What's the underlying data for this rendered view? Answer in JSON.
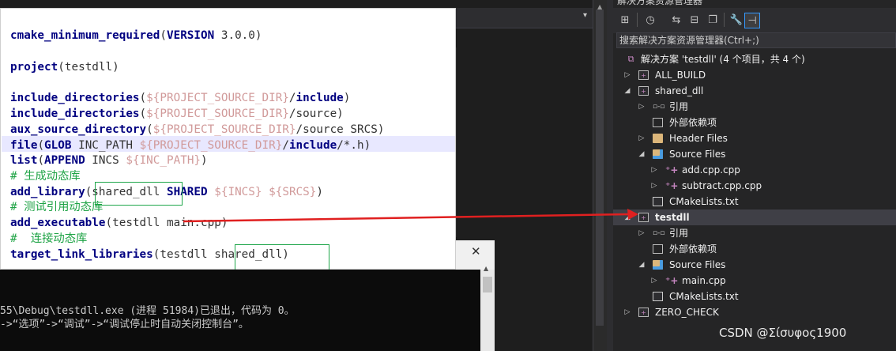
{
  "code": {
    "lines": [
      [
        {
          "t": "kw",
          "s": "cmake_minimum_required"
        },
        {
          "t": "plain",
          "s": "("
        },
        {
          "t": "kw",
          "s": "VERSION"
        },
        {
          "t": "plain",
          "s": " 3.0.0)"
        }
      ],
      [],
      [
        {
          "t": "kw",
          "s": "project"
        },
        {
          "t": "plain",
          "s": "(testdll)"
        }
      ],
      [],
      [
        {
          "t": "kw",
          "s": "include_directories"
        },
        {
          "t": "plain",
          "s": "("
        },
        {
          "t": "var",
          "s": "${PROJECT_SOURCE_DIR}"
        },
        {
          "t": "plain",
          "s": "/"
        },
        {
          "t": "kw",
          "s": "include"
        },
        {
          "t": "plain",
          "s": ")"
        }
      ],
      [
        {
          "t": "kw",
          "s": "include_directories"
        },
        {
          "t": "plain",
          "s": "("
        },
        {
          "t": "var",
          "s": "${PROJECT_SOURCE_DIR}"
        },
        {
          "t": "plain",
          "s": "/source)"
        }
      ],
      [
        {
          "t": "kw",
          "s": "aux_source_directory"
        },
        {
          "t": "plain",
          "s": "("
        },
        {
          "t": "var",
          "s": "${PROJECT_SOURCE_DIR}"
        },
        {
          "t": "plain",
          "s": "/source SRCS)"
        }
      ],
      [
        {
          "t": "kw",
          "s": "file"
        },
        {
          "t": "plain",
          "s": "("
        },
        {
          "t": "kw",
          "s": "GLOB"
        },
        {
          "t": "plain",
          "s": " INC_PATH "
        },
        {
          "t": "var",
          "s": "${PROJECT_SOURCE_DIR}"
        },
        {
          "t": "plain",
          "s": "/"
        },
        {
          "t": "kw",
          "s": "include"
        },
        {
          "t": "plain",
          "s": "/*.h)"
        }
      ],
      [
        {
          "t": "kw",
          "s": "list"
        },
        {
          "t": "plain",
          "s": "("
        },
        {
          "t": "kw",
          "s": "APPEND"
        },
        {
          "t": "plain",
          "s": " INCS "
        },
        {
          "t": "var",
          "s": "${INC_PATH}"
        },
        {
          "t": "plain",
          "s": ")"
        }
      ],
      [
        {
          "t": "cmt",
          "s": "# 生成动态库"
        }
      ],
      [
        {
          "t": "kw",
          "s": "add_library"
        },
        {
          "t": "plain",
          "s": "(shared_dll "
        },
        {
          "t": "kw",
          "s": "SHARED"
        },
        {
          "t": "plain",
          "s": " "
        },
        {
          "t": "var",
          "s": "${INCS}"
        },
        {
          "t": "plain",
          "s": " "
        },
        {
          "t": "var",
          "s": "${SRCS}"
        },
        {
          "t": "plain",
          "s": ")"
        }
      ],
      [
        {
          "t": "cmt",
          "s": "# 测试引用动态库"
        }
      ],
      [
        {
          "t": "kw",
          "s": "add_executable"
        },
        {
          "t": "plain",
          "s": "(testdll main.cpp)"
        }
      ],
      [
        {
          "t": "cmt",
          "s": "#  连接动态库"
        }
      ],
      [
        {
          "t": "kw",
          "s": "target_link_libraries"
        },
        {
          "t": "plain",
          "s": "(testdll shared_dll)"
        }
      ]
    ]
  },
  "console": {
    "close_label": "✕",
    "line1": "55\\Debug\\testdll.exe (进程 51984)已退出，代码为 0。",
    "line2": "->“选项”->“调试”->“调试停止时自动关闭控制台”。"
  },
  "solution_explorer": {
    "title": "解决方案资源管理器",
    "search_placeholder": "搜索解决方案资源管理器(Ctrl+;)",
    "tree": [
      {
        "label": "解决方案 'testdll' (4 个项目，共 4 个)",
        "icon": "solution-icon",
        "glyph": "⧉",
        "ic": "ic-sln",
        "indent": 0,
        "arrow": ""
      },
      {
        "label": "ALL_BUILD",
        "icon": "project-icon",
        "glyph": "+",
        "ic": "ic-proj",
        "indent": 1,
        "arrow": "▷"
      },
      {
        "label": "shared_dll",
        "icon": "project-icon",
        "glyph": "+",
        "ic": "ic-proj",
        "indent": 1,
        "arrow": "◢"
      },
      {
        "label": "引用",
        "icon": "references-icon",
        "glyph": "▫-▫",
        "ic": "ic-ref",
        "indent": 2,
        "arrow": "▷"
      },
      {
        "label": "外部依赖项",
        "icon": "external-deps-icon",
        "glyph": "",
        "ic": "ic-ext",
        "indent": 2,
        "arrow": ""
      },
      {
        "label": "Header Files",
        "icon": "folder-icon",
        "glyph": "",
        "ic": "ic-folder",
        "indent": 2,
        "arrow": "▷"
      },
      {
        "label": "Source Files",
        "icon": "folder-icon",
        "glyph": "",
        "ic": "ic-folder-blue",
        "indent": 2,
        "arrow": "◢"
      },
      {
        "label": "add.cpp.cpp",
        "icon": "cpp-file-icon",
        "glyph": "⁺+",
        "ic": "ic-cpp",
        "indent": 3,
        "arrow": "▷"
      },
      {
        "label": "subtract.cpp.cpp",
        "icon": "cpp-file-icon",
        "glyph": "⁺+",
        "ic": "ic-cpp",
        "indent": 3,
        "arrow": "▷"
      },
      {
        "label": "CMakeLists.txt",
        "icon": "text-file-icon",
        "glyph": "",
        "ic": "ic-txt",
        "indent": 2,
        "arrow": ""
      },
      {
        "label": "testdll",
        "icon": "project-icon",
        "glyph": "+",
        "ic": "ic-proj",
        "indent": 1,
        "arrow": "◢",
        "bold": true,
        "selected": true
      },
      {
        "label": "引用",
        "icon": "references-icon",
        "glyph": "▫-▫",
        "ic": "ic-ref",
        "indent": 2,
        "arrow": "▷"
      },
      {
        "label": "外部依赖项",
        "icon": "external-deps-icon",
        "glyph": "",
        "ic": "ic-ext",
        "indent": 2,
        "arrow": ""
      },
      {
        "label": "Source Files",
        "icon": "folder-icon",
        "glyph": "",
        "ic": "ic-folder-blue",
        "indent": 2,
        "arrow": "◢"
      },
      {
        "label": "main.cpp",
        "icon": "cpp-file-icon",
        "glyph": "⁺+",
        "ic": "ic-cpp",
        "indent": 3,
        "arrow": "▷"
      },
      {
        "label": "CMakeLists.txt",
        "icon": "text-file-icon",
        "glyph": "",
        "ic": "ic-txt",
        "indent": 2,
        "arrow": ""
      },
      {
        "label": "ZERO_CHECK",
        "icon": "project-icon",
        "glyph": "+",
        "ic": "ic-proj",
        "indent": 1,
        "arrow": "▷"
      }
    ]
  },
  "toolbar": {
    "buttons": [
      {
        "name": "switch-views-icon",
        "glyph": "⊞"
      },
      {
        "name": "history-icon",
        "glyph": "◷"
      },
      {
        "name": "pending-changes-icon",
        "glyph": "⇆"
      },
      {
        "name": "collapse-all-icon",
        "glyph": "⊟"
      },
      {
        "name": "show-all-files-icon",
        "glyph": "❐"
      },
      {
        "name": "properties-icon",
        "glyph": "🔧"
      },
      {
        "name": "preview-selected-icon",
        "glyph": "⊣"
      }
    ]
  },
  "watermark": "CSDN @Σίσυφος1900",
  "colors": {
    "arrow": "#e02020",
    "box": "#1fa64a"
  }
}
